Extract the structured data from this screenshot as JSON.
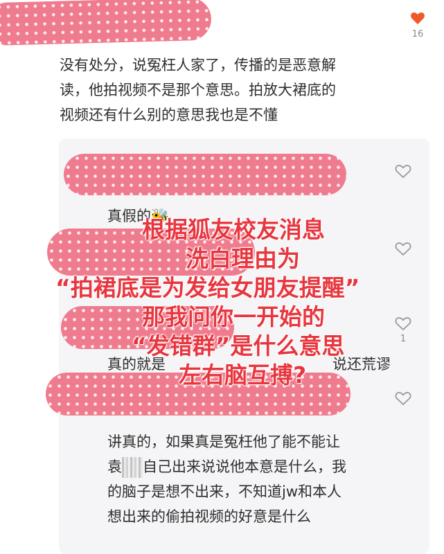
{
  "top_comment": {
    "like_count": "16",
    "text_lines": [
      "没有处分，说冤枉人家了，传播的是恶意解",
      "读，他拍视频不是那个意思。拍放大裙底的",
      "视频还有什么别的意思我也是不懂"
    ]
  },
  "replies": [
    {
      "text": "真假的🐝"
    },
    {
      "text": "真的就是"
    },
    {
      "text": "说还荒谬"
    },
    {
      "like_count": "1"
    },
    {
      "text_lines": [
        "讲真的，如果真是冤枉他了能不能让",
        "袁",
        "自己出来说说他本意是什么，我",
        "的脑子是想不出来，不知道jw和本人",
        "想出来的偷拍视频的好意是什么"
      ]
    }
  ],
  "overlay": {
    "lines": [
      "根据狐友校友消息",
      "洗白理由为",
      "“拍裙底是为发给女朋友提醒”",
      "那我问你一开始的",
      "“发错群”是什么意思",
      "左右脑互搏?"
    ]
  },
  "colors": {
    "heart": "#f05a28",
    "overlay_text": "#e8363f",
    "blob": "#ef7c8e"
  }
}
